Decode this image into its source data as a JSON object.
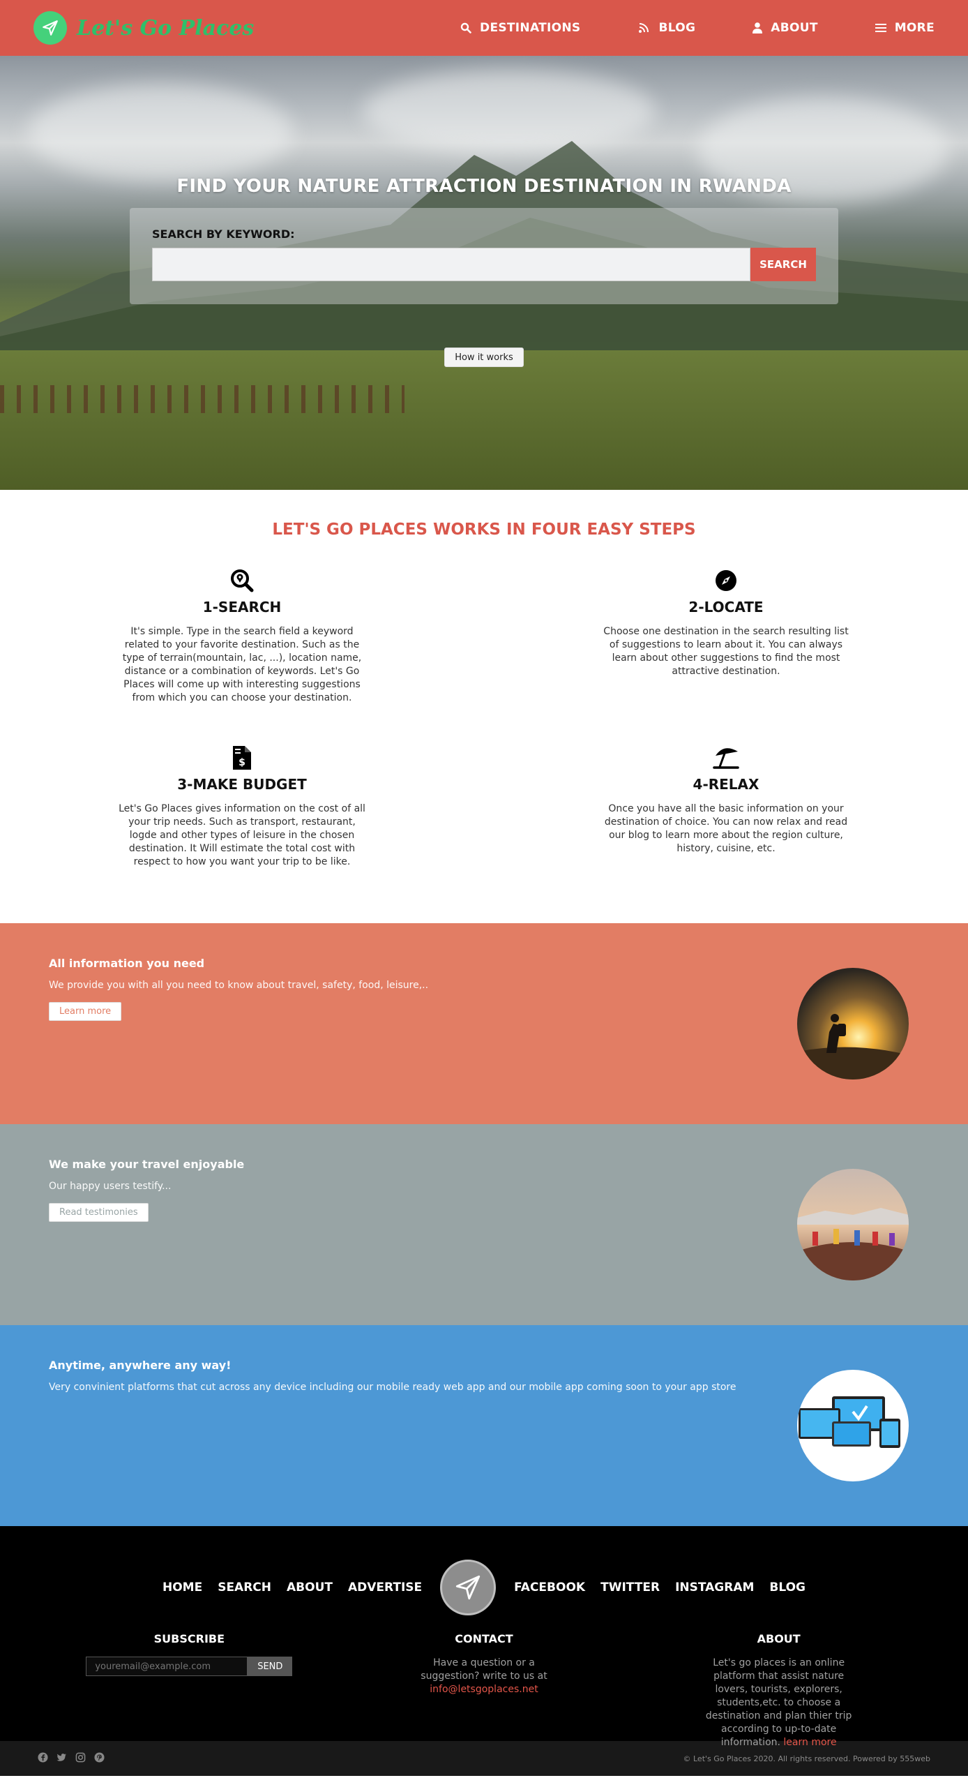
{
  "nav": {
    "brand": "Let's Go Places",
    "items": [
      {
        "label": "DESTINATIONS",
        "icon": "search-icon"
      },
      {
        "label": "BLOG",
        "icon": "blog-icon"
      },
      {
        "label": "ABOUT",
        "icon": "user-icon"
      },
      {
        "label": "MORE",
        "icon": "menu-icon"
      }
    ]
  },
  "hero": {
    "title": "FIND YOUR NATURE ATTRACTION DESTINATION IN RWANDA",
    "search_label": "SEARCH BY KEYWORD:",
    "search_value": "",
    "search_button": "SEARCH",
    "how_button": "How it works"
  },
  "steps": {
    "title": "LET'S GO PLACES WORKS IN FOUR EASY STEPS",
    "items": [
      {
        "icon": "search-location-icon",
        "title": "1-SEARCH",
        "text": "It's simple. Type in the search field a keyword related to your favorite destination. Such as the type of terrain(mountain, lac, ...), location name, distance or a combination of keywords. Let's Go Places will come up with interesting suggestions from which you can choose your destination."
      },
      {
        "icon": "compass-icon",
        "title": "2-LOCATE",
        "text": "Choose one destination in the search resulting list of suggestions to learn about it. You can always learn about other suggestions to find the most attractive destination."
      },
      {
        "icon": "invoice-dollar-icon",
        "title": "3-MAKE BUDGET",
        "text": "Let's Go Places gives information on the cost of all your trip needs. Such as transport, restaurant, logde and other types of leisure in the chosen destination. It Will estimate the total cost with respect to how you want your trip to be like."
      },
      {
        "icon": "umbrella-beach-icon",
        "title": "4-RELAX",
        "text": "Once you have all the basic information on your destination of choice. You can now relax and read our blog to learn more about the region culture, history, cuisine, etc."
      }
    ]
  },
  "bands": [
    {
      "title": "All information you need",
      "text": "We provide you with all you need to know about travel, safety, food, leisure,..",
      "button": "Learn more",
      "bg": "#e27d64",
      "btn_color": "#e27d64"
    },
    {
      "title": "We make your travel enjoyable",
      "text": "Our happy users testify...",
      "button": "Read testimonies",
      "bg": "#98a4a5",
      "btn_color": "#98a4a5"
    },
    {
      "title": "Anytime, anywhere any way!",
      "text": "Very convinient platforms that cut across any device including our mobile ready web app and our mobile app coming soon to your app store",
      "button": "",
      "bg": "#4d98d5",
      "btn_color": ""
    }
  ],
  "footer": {
    "links_left": [
      "HOME",
      "SEARCH",
      "ABOUT",
      "ADVERTISE"
    ],
    "links_right": [
      "FACEBOOK",
      "TWITTER",
      "INSTAGRAM",
      "BLOG"
    ],
    "subscribe": {
      "title": "SUBSCRIBE",
      "placeholder": "youremail@example.com",
      "button": "SEND"
    },
    "contact": {
      "title": "CONTACT",
      "text": "Have a question or a suggestion? write to us at",
      "email": "info@letsgoplaces.net"
    },
    "about": {
      "title": "ABOUT",
      "text": "Let's go places is an online platform that assist nature lovers, tourists, explorers, students,etc. to choose a destination and plan thier trip according to up-to-date information.",
      "link": "learn more"
    },
    "socials": [
      "facebook-icon",
      "twitter-icon",
      "instagram-icon",
      "pinterest-icon"
    ],
    "copyright": "© Let's Go Places 2020. All rights reserved. Powered by 555web"
  }
}
